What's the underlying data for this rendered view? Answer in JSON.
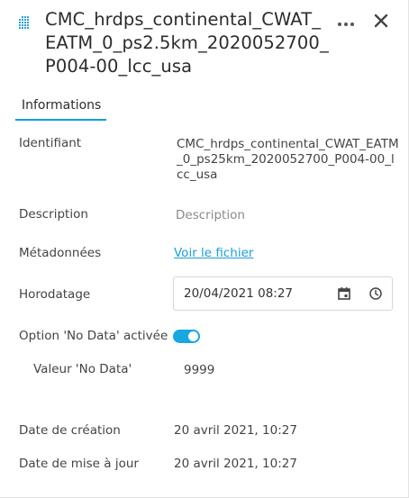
{
  "header": {
    "title": "CMC_hrdps_continental_CWAT_EATM_0_ps2.5km_2020052700_P004-00_lcc_usa",
    "layer_icon": "grid-layer-icon",
    "more_icon": "ellipsis-icon",
    "close_icon": "close-icon"
  },
  "tabs": [
    {
      "label": "Informations",
      "active": true
    }
  ],
  "info": {
    "identifier_label": "Identifiant",
    "identifier_value": "CMC_hrdps_continental_CWAT_EATM_0_ps25km_2020052700_P004-00_lcc_usa",
    "description_label": "Description",
    "description_placeholder": "Description",
    "metadata_label": "Métadonnées",
    "metadata_link": "Voir le fichier",
    "timestamp_label": "Horodatage",
    "timestamp_value": "20/04/2021 08:27",
    "calendar_icon": "calendar-icon",
    "clock_icon": "clock-icon",
    "nodata_option_label": "Option 'No Data' activée",
    "nodata_option_enabled": true,
    "nodata_value_label": "Valeur 'No Data'",
    "nodata_value": "9999",
    "created_label": "Date de création",
    "created_value": "20 avril 2021, 10:27",
    "updated_label": "Date de mise à jour",
    "updated_value": "20 avril 2021, 10:27"
  },
  "colors": {
    "accent": "#00a0dc",
    "link": "#1a9fd9",
    "text": "#444444",
    "placeholder": "#8a8a8a"
  }
}
